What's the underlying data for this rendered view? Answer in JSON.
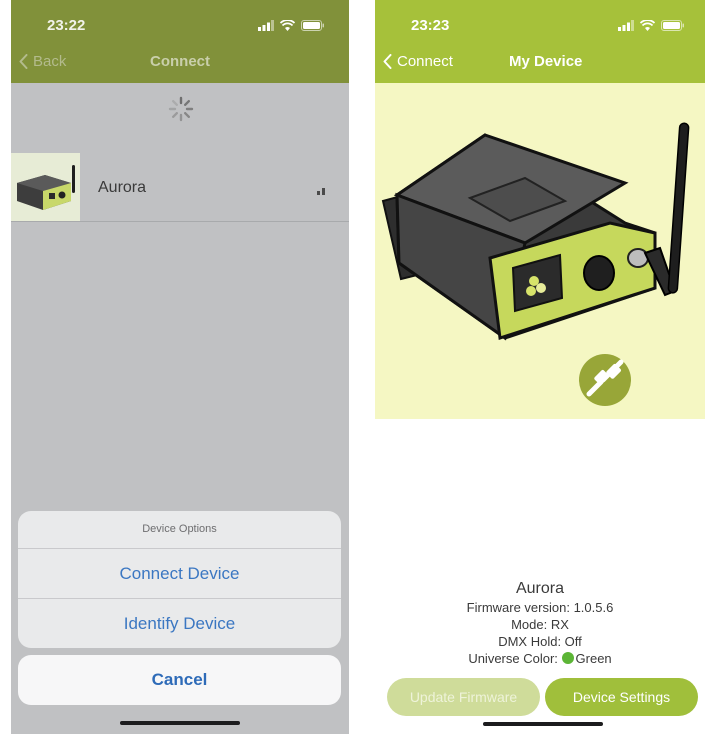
{
  "left_screen": {
    "status": {
      "time": "23:22"
    },
    "nav": {
      "back_label": "Back",
      "title": "Connect"
    },
    "device_list": [
      {
        "name": "Aurora"
      }
    ],
    "sheet": {
      "title": "Device Options",
      "items": [
        "Connect Device",
        "Identify Device"
      ],
      "cancel_label": "Cancel"
    }
  },
  "right_screen": {
    "status": {
      "time": "23:23"
    },
    "nav": {
      "back_label": "Connect",
      "title": "My Device"
    },
    "device": {
      "name": "Aurora",
      "firmware": "Firmware version: 1.0.5.6",
      "mode": "Mode: RX",
      "dmx_hold": "DMX Hold: Off",
      "universe_color_label": "Universe Color:",
      "universe_color_name": "Green",
      "universe_color_hex": "#5cb536"
    },
    "buttons": {
      "update_firmware": "Update Firmware",
      "device_settings": "Device Settings"
    }
  },
  "colors": {
    "left_nav": "#81913a",
    "right_nav": "#a6c13a",
    "hero_bg": "#f5f7c3",
    "link_blue": "#3b77c2"
  },
  "icons": [
    "chevron-left-icon",
    "signal-icon",
    "wifi-icon",
    "battery-icon",
    "spinner-icon",
    "plug-icon",
    "antenna-icon"
  ]
}
